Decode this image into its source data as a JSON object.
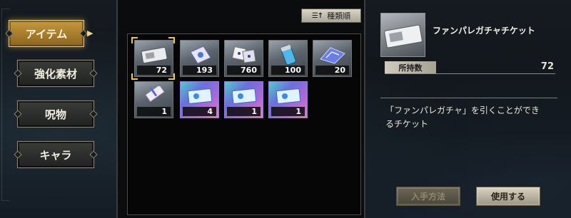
{
  "nav": {
    "items": [
      {
        "label": "アイテム",
        "active": true
      },
      {
        "label": "強化素材",
        "active": false
      },
      {
        "label": "呪物",
        "active": false
      },
      {
        "label": "キャラ",
        "active": false
      }
    ]
  },
  "sort": {
    "label": "種類順",
    "icon": "sort-icon"
  },
  "inventory": {
    "items": [
      {
        "count": "72",
        "icon": "gacha-ticket-icon",
        "selected": true
      },
      {
        "count": "193",
        "icon": "charm-bag-icon"
      },
      {
        "count": "760",
        "icon": "dice-icon"
      },
      {
        "count": "100",
        "icon": "canister-icon"
      },
      {
        "count": "20",
        "icon": "crystal-cloth-icon"
      },
      {
        "count": "1",
        "icon": "talisman-icon"
      },
      {
        "count": "4",
        "icon": "holo-ticket-icon"
      },
      {
        "count": "1",
        "icon": "holo-ticket-icon"
      },
      {
        "count": "1",
        "icon": "holo-ticket-icon"
      }
    ]
  },
  "detail": {
    "name": "ファンパレガチャチケット",
    "owned_label": "所持数",
    "owned_value": "72",
    "description_line1": "「ファンパレガチャ」を引くことができ",
    "description_line2": "るチケット",
    "acquire_label": "入手方法",
    "use_label": "使用する"
  },
  "colors": {
    "accent_gold": "#c79a3c",
    "selected_outline": "#f2c74d"
  }
}
